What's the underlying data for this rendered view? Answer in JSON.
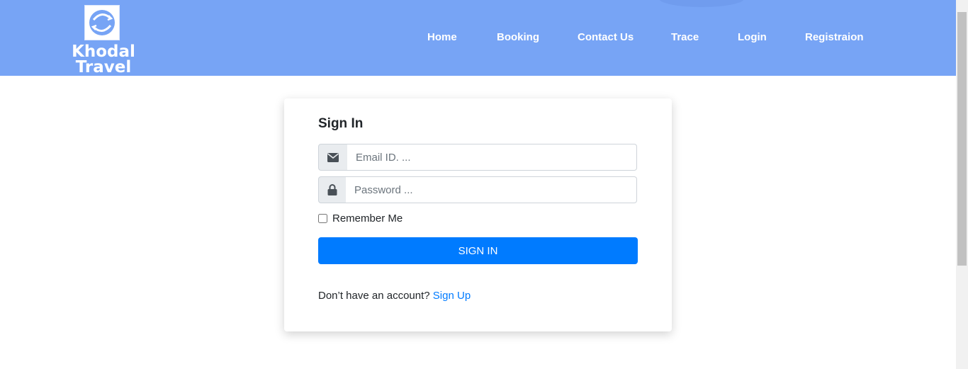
{
  "brand": {
    "logo_lines": [
      "Khodal",
      "Travel"
    ],
    "logo_icon": "globe-arrows-icon"
  },
  "nav": {
    "items": [
      {
        "label": "Home"
      },
      {
        "label": "Booking"
      },
      {
        "label": "Contact Us"
      },
      {
        "label": "Trace"
      },
      {
        "label": "Login"
      },
      {
        "label": "Registraion"
      }
    ]
  },
  "signin": {
    "title": "Sign In",
    "email": {
      "placeholder": "Email ID. ...",
      "value": "",
      "icon": "envelope-icon"
    },
    "password": {
      "placeholder": "Password ...",
      "value": "",
      "icon": "lock-icon"
    },
    "remember_label": "Remember Me",
    "remember_checked": false,
    "submit_label": "SIGN IN",
    "footer_text": "Don’t have an account?",
    "footer_link": "Sign Up"
  },
  "colors": {
    "navbar": "#77a4f5",
    "primary": "#007bff",
    "addon_bg": "#e9ecef"
  }
}
